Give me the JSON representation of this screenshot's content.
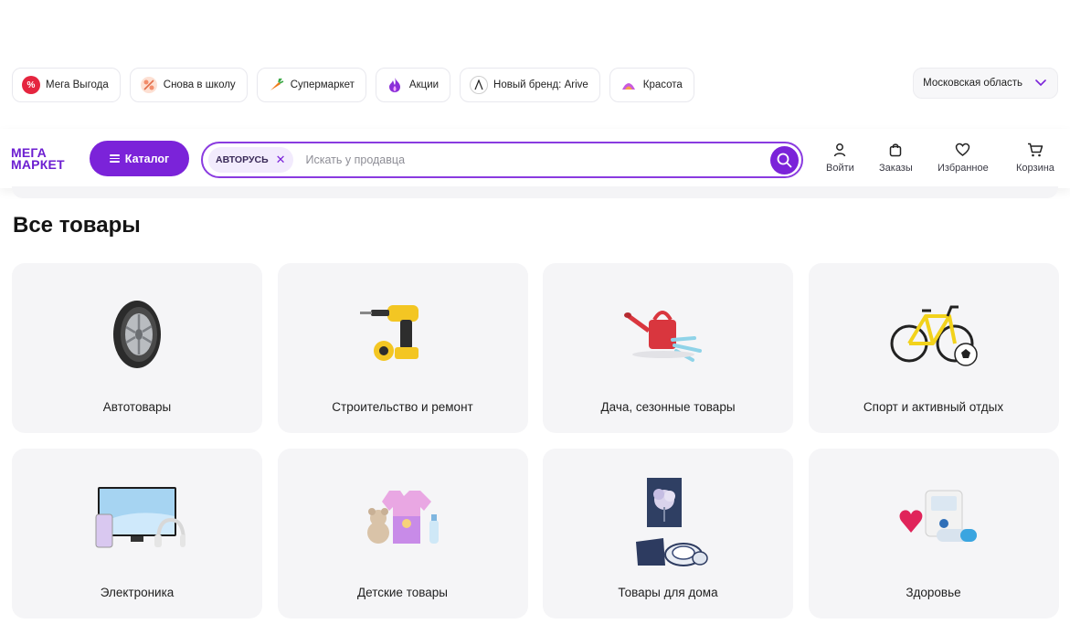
{
  "promos": [
    {
      "label": "Мега Выгода",
      "icon": "percent-icon",
      "color": "#e5253f"
    },
    {
      "label": "Снова в школу",
      "icon": "school-icon",
      "color": "#f28c6b"
    },
    {
      "label": "Супермаркет",
      "icon": "carrot-icon",
      "color": "#f07a1a"
    },
    {
      "label": "Акции",
      "icon": "flame-icon",
      "color": "#8b2fd8"
    },
    {
      "label": "Новый бренд: Arive",
      "icon": "arive-logo-icon",
      "color": "#222222"
    },
    {
      "label": "Красота",
      "icon": "beauty-icon",
      "color": "#c85adf"
    }
  ],
  "region": {
    "label": "Московская область"
  },
  "header": {
    "logo_line1": "МЕГА",
    "logo_line2": "МАРКЕТ",
    "catalog_label": "Каталог",
    "search_tag": "АВТОРУСЬ",
    "search_placeholder": "Искать у продавца",
    "nav": {
      "login": "Войти",
      "orders": "Заказы",
      "favorites": "Избранное",
      "cart": "Корзина"
    }
  },
  "page_title": "Все товары",
  "categories": [
    {
      "label": "Автотовары"
    },
    {
      "label": "Строительство и ремонт"
    },
    {
      "label": "Дача, сезонные товары"
    },
    {
      "label": "Спорт и активный отдых"
    },
    {
      "label": "Электроника"
    },
    {
      "label": "Детские товары"
    },
    {
      "label": "Товары для дома"
    },
    {
      "label": "Здоровье"
    }
  ],
  "colors": {
    "accent": "#7b23d9",
    "card_bg": "#f5f5f7"
  }
}
